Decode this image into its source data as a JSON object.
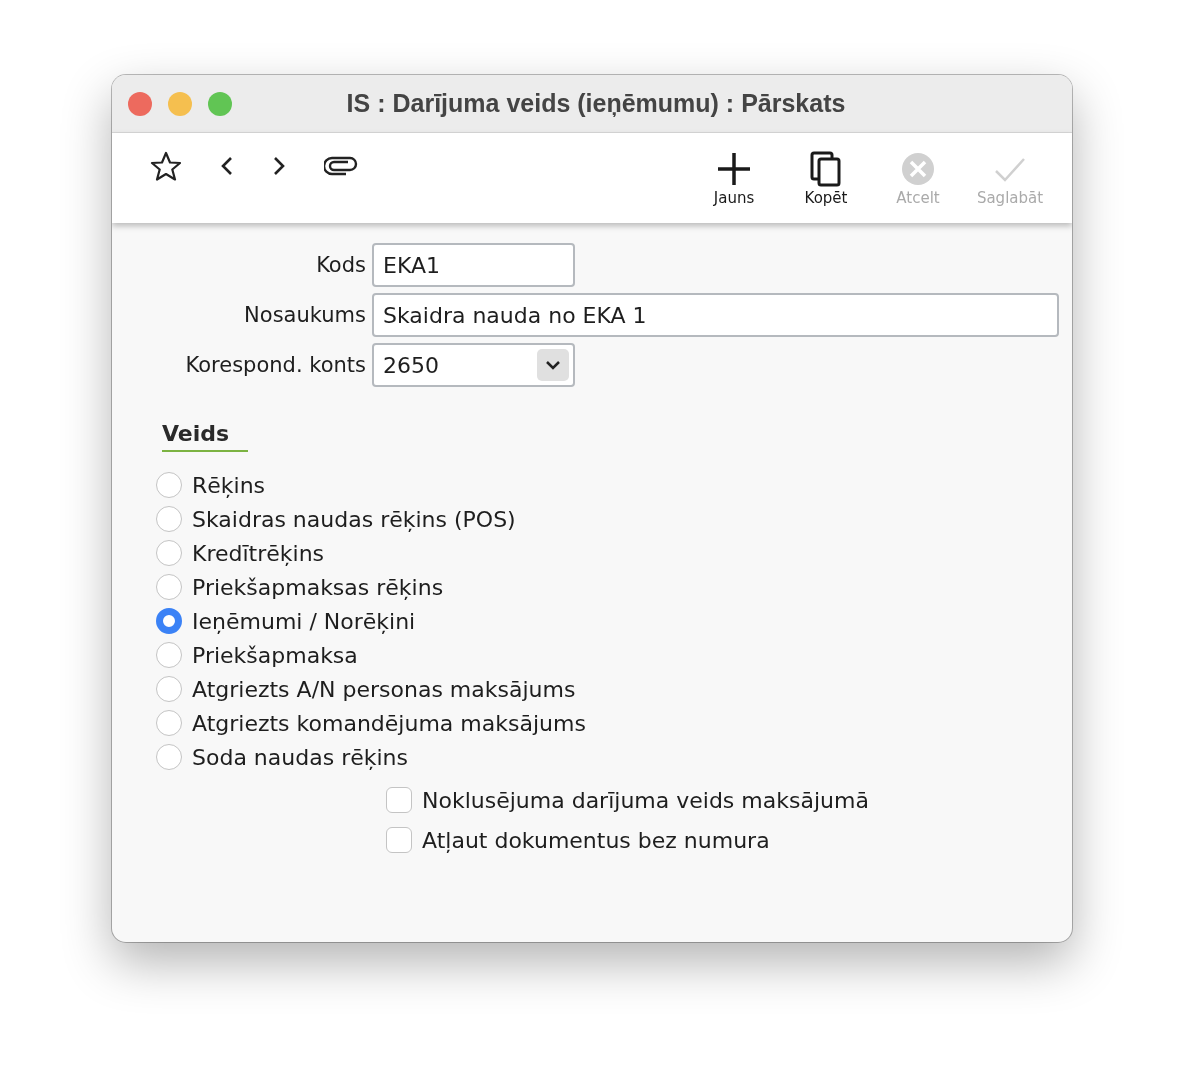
{
  "window": {
    "title": "IS : Darījuma veids (ieņēmumu) : Pārskats"
  },
  "toolbar": {
    "actions": [
      {
        "kind": "add",
        "label": "Jauns",
        "disabled": false
      },
      {
        "kind": "copy",
        "label": "Kopēt",
        "disabled": false
      },
      {
        "kind": "cancel",
        "label": "Atcelt",
        "disabled": true
      },
      {
        "kind": "save",
        "label": "Saglabāt",
        "disabled": true
      }
    ]
  },
  "form": {
    "fields": [
      {
        "kind": "text",
        "label": "Kods",
        "value": "EKA1",
        "wide": false
      },
      {
        "kind": "text",
        "label": "Nosaukums",
        "value": "Skaidra nauda no EKA 1",
        "wide": true
      },
      {
        "kind": "select",
        "label": "Korespond. konts",
        "value": "2650",
        "wide": false
      }
    ]
  },
  "type_section": {
    "heading": "Veids",
    "options": [
      {
        "label": "Rēķins",
        "selected": false
      },
      {
        "label": "Skaidras naudas rēķins (POS)",
        "selected": false
      },
      {
        "label": "Kredītrēķins",
        "selected": false
      },
      {
        "label": "Priekšapmaksas rēķins",
        "selected": false
      },
      {
        "label": "Ieņēmumi / Norēķini",
        "selected": true
      },
      {
        "label": "Priekšapmaksa",
        "selected": false
      },
      {
        "label": "Atgriezts A/N personas maksājums",
        "selected": false
      },
      {
        "label": "Atgriezts komandējuma maksājums",
        "selected": false
      },
      {
        "label": "Soda naudas rēķins",
        "selected": false
      }
    ]
  },
  "checkboxes": [
    {
      "label": "Noklusējuma darījuma veids maksājumā",
      "checked": false
    },
    {
      "label": "Atļaut dokumentus bez numura",
      "checked": false
    }
  ]
}
